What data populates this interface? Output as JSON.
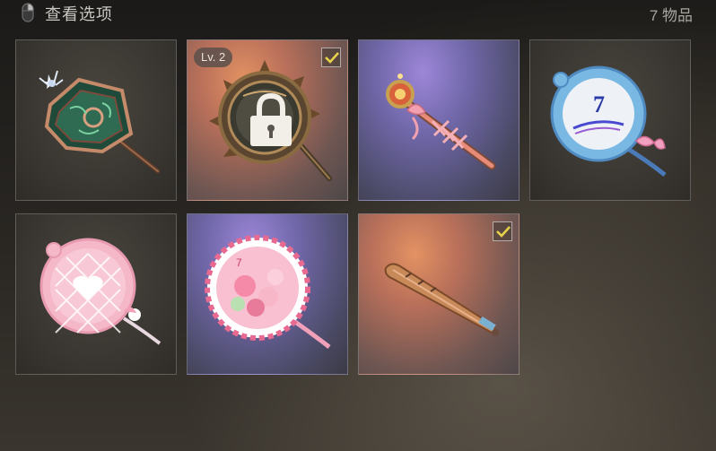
{
  "header": {
    "title": "查看选项",
    "count": "7 物品",
    "icon": "mouse-icon"
  },
  "items": [
    {
      "id": "green-ornate-fan",
      "rarity": "common",
      "level": null,
      "locked": false,
      "checked": false,
      "icon": "green-ornate-fan-icon"
    },
    {
      "id": "bronze-sun-mirror",
      "rarity": "orange",
      "level": "Lv. 2",
      "locked": true,
      "checked": true,
      "icon": "bronze-sun-mirror-icon"
    },
    {
      "id": "ribbon-wand",
      "rarity": "purple",
      "level": null,
      "locked": false,
      "checked": false,
      "icon": "ribbon-wand-icon"
    },
    {
      "id": "blue-anniversary-fan",
      "rarity": "common",
      "level": null,
      "locked": false,
      "checked": false,
      "icon": "blue-anniversary-fan-icon"
    },
    {
      "id": "pink-heart-fan",
      "rarity": "common",
      "level": null,
      "locked": false,
      "checked": false,
      "icon": "pink-heart-fan-icon"
    },
    {
      "id": "pink-floral-fan",
      "rarity": "purple",
      "level": null,
      "locked": false,
      "checked": false,
      "icon": "pink-floral-fan-icon"
    },
    {
      "id": "baseball-bat",
      "rarity": "orange",
      "level": null,
      "locked": false,
      "checked": true,
      "icon": "baseball-bat-icon"
    }
  ],
  "colors": {
    "check": "#e6d24a",
    "title_text": "#c9c7c2"
  }
}
